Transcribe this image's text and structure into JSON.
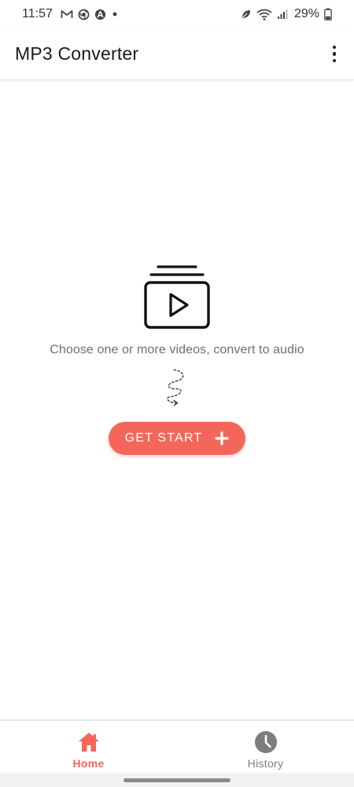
{
  "status_bar": {
    "time": "11:57",
    "left_icons": [
      "gmail-icon",
      "chrome-icon",
      "accessibility-icon",
      "dot-icon"
    ],
    "right_icons": [
      "leaf-icon",
      "wifi-icon",
      "signal-icon",
      "battery-icon"
    ],
    "battery_percent": "29%"
  },
  "app_bar": {
    "title": "MP3 Converter",
    "menu_icon": "more-vert-icon"
  },
  "empty_state": {
    "icon": "video-stack-icon",
    "message": "Choose one or more videos, convert to audio",
    "arrow_icon": "dashed-arrow-icon",
    "button_label": "GET START",
    "button_icon": "plus-icon"
  },
  "bottom_nav": {
    "items": [
      {
        "label": "Home",
        "icon": "home-icon",
        "active": true
      },
      {
        "label": "History",
        "icon": "history-icon",
        "active": false
      }
    ]
  },
  "colors": {
    "accent": "#f5665a",
    "inactive": "#7d7d7d",
    "text_primary": "#1b1b1b",
    "text_secondary": "#6f6f6f"
  }
}
